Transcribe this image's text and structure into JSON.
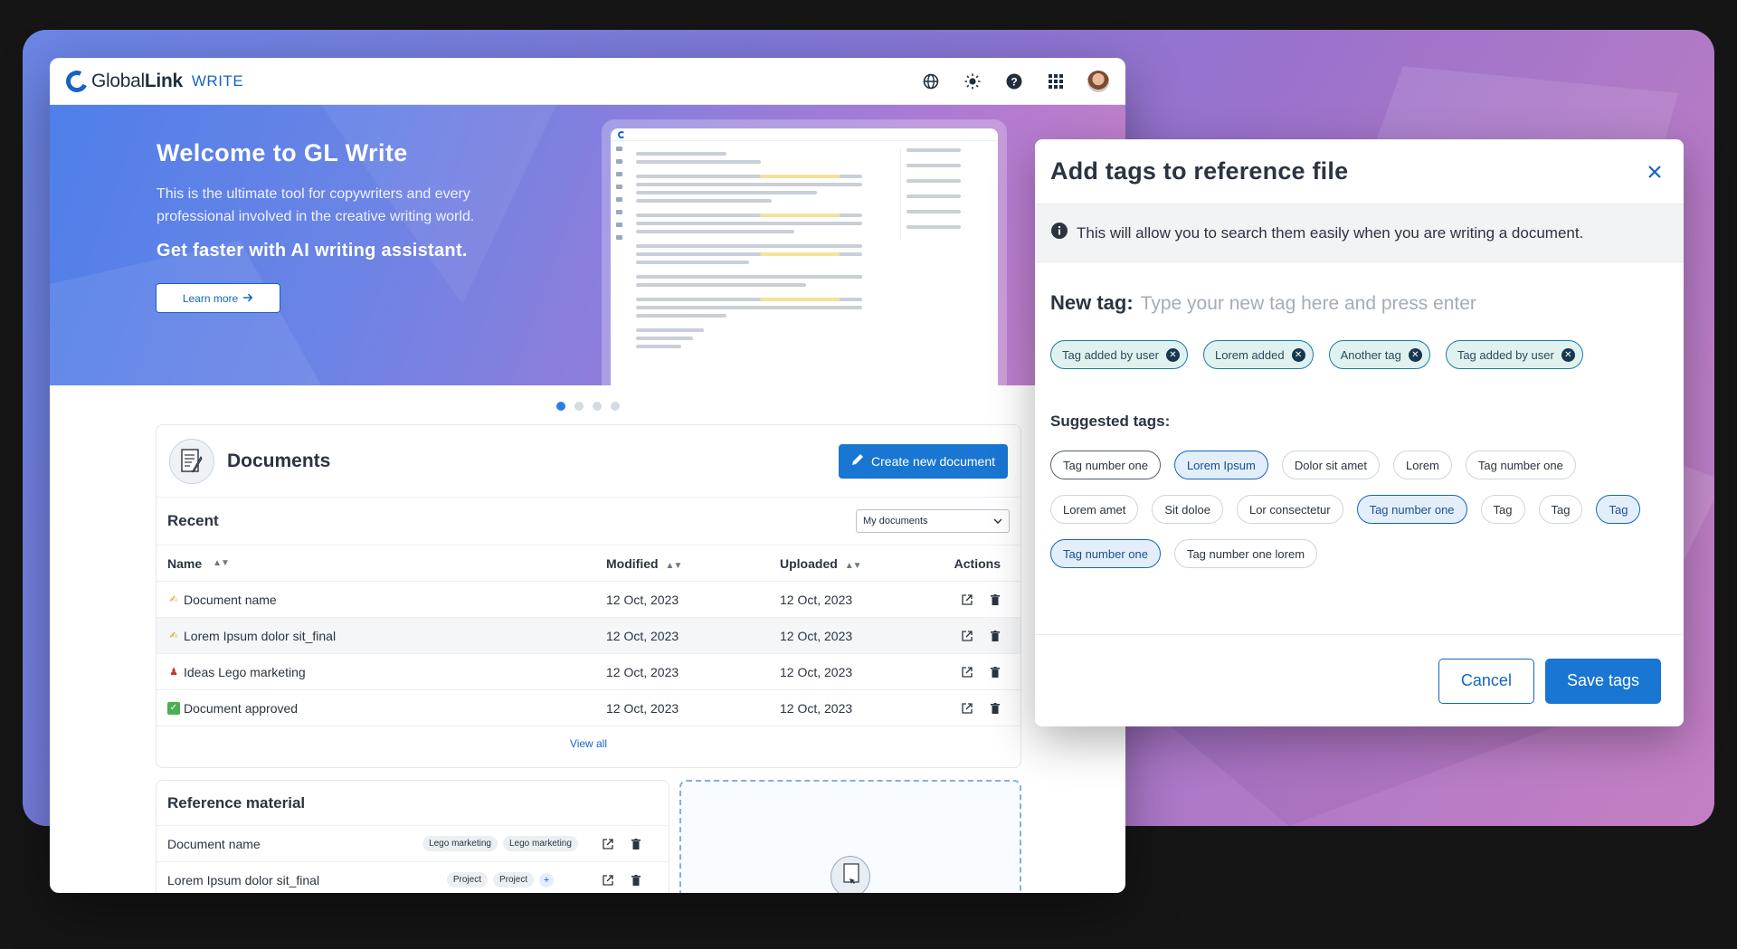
{
  "app": {
    "logo_global": "Global",
    "logo_link": "Link",
    "logo_sub": "WRITE",
    "top_icons": [
      "globe-icon",
      "brightness-icon",
      "help-icon",
      "apps-grid-icon",
      "user-avatar"
    ]
  },
  "hero": {
    "title": "Welcome to GL Write",
    "text": "This is the ultimate tool for copywriters and every professional involved in the creative writing world.",
    "subtitle": "Get faster with AI writing assistant.",
    "button_label": "Learn more",
    "carousel_pages": 4,
    "carousel_active": 1
  },
  "documents": {
    "title": "Documents",
    "create_button": "Create new document",
    "recent_title": "Recent",
    "filter_value": "My documents",
    "columns": {
      "name": "Name",
      "modified": "Modified",
      "uploaded": "Uploaded",
      "actions": "Actions"
    },
    "rows": [
      {
        "icon": "writing-hand-icon",
        "name": "Document name",
        "modified": "12 Oct, 2023",
        "uploaded": "12 Oct, 2023"
      },
      {
        "icon": "writing-hand-icon",
        "name": "Lorem Ipsum dolor sit_final",
        "modified": "12 Oct, 2023",
        "uploaded": "12 Oct, 2023"
      },
      {
        "icon": "lego-figure-icon",
        "name": "Ideas Lego marketing",
        "modified": "12 Oct, 2023",
        "uploaded": "12 Oct, 2023"
      },
      {
        "icon": "check-mark-icon",
        "name": "Document approved",
        "modified": "12 Oct, 2023",
        "uploaded": "12 Oct, 2023"
      }
    ],
    "view_all": "View all"
  },
  "reference": {
    "title": "Reference material",
    "rows": [
      {
        "name": "Document name",
        "chips": [
          "Lego marketing",
          "Lego marketing"
        ]
      },
      {
        "name": "Lorem Ipsum dolor sit_final",
        "chips": [
          "Project",
          "Project"
        ],
        "add": "+"
      }
    ]
  },
  "modal": {
    "title": "Add tags to reference file",
    "info": "This will allow you to search them easily when you are writing a document.",
    "new_tag_label": "New tag:",
    "new_tag_placeholder": "Type your new tag here and press enter",
    "added_tags": [
      "Tag added by user",
      "Lorem added",
      "Another tag",
      "Tag added by user"
    ],
    "suggested_label": "Suggested tags:",
    "suggested_tags": [
      {
        "label": "Tag number one",
        "state": "hover"
      },
      {
        "label": "Lorem Ipsum",
        "state": "selected"
      },
      {
        "label": "Dolor sit amet",
        "state": "default"
      },
      {
        "label": "Lorem",
        "state": "default"
      },
      {
        "label": "Tag number one",
        "state": "default"
      },
      {
        "label": "Lorem amet",
        "state": "default"
      },
      {
        "label": "Sit doloe",
        "state": "default"
      },
      {
        "label": "Lor consectetur",
        "state": "default"
      },
      {
        "label": "Tag number one",
        "state": "selected"
      },
      {
        "label": "Tag",
        "state": "default"
      },
      {
        "label": "Tag",
        "state": "default"
      },
      {
        "label": "Tag",
        "state": "selected"
      },
      {
        "label": "Tag number one",
        "state": "selected"
      },
      {
        "label": "Tag number one lorem",
        "state": "default"
      }
    ],
    "cancel": "Cancel",
    "save": "Save tags"
  },
  "colors": {
    "primary": "#1976d2",
    "tag_added_bg": "#dff2f0",
    "tag_selected_bg": "#e3eefb"
  }
}
